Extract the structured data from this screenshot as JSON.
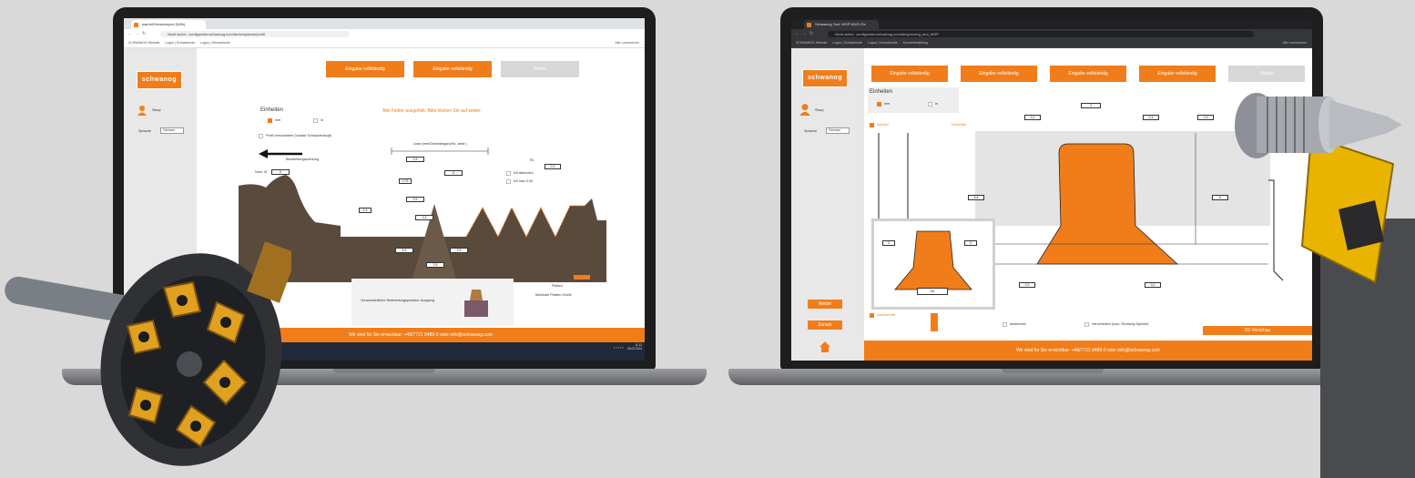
{
  "left_screen": {
    "browser": {
      "tab_title": "warnbl/Gewindeprof (Wilh)",
      "url_prefix": "Nicht sicher",
      "url": "configurator.schwanog.com/de/zerspanen/profil",
      "bookmarks": [
        "SCHWANOG Website",
        "Logos | Schwafmede",
        "Logos | Schwafmede"
      ],
      "bookmark_right": "Alle Lesezeichen"
    },
    "logo_text": "schwanog",
    "user_label": "Stavy",
    "language_label": "Sprache",
    "language_value": "German",
    "buttons": {
      "step1": "Eingabe vollständig",
      "step2": "Eingabe vollständig",
      "next": "Weiter"
    },
    "units": {
      "title": "Einheiten",
      "mm": "mm",
      "in": "in"
    },
    "profile_option": "Profil verschieben (Vorlauf Schraubenkopf)",
    "status_message": "Alle Felder ausgefüllt. Bitte klicken Sie auf weiter.",
    "direction_label": "Bearbeitungsrichtung",
    "lead_label": "Lead (mm/Gewindeganz/Nr. zahlr.)",
    "diameter_label": "Nom. Ø",
    "diameter_value": "6",
    "dims": {
      "p_value": "1,6",
      "a_value": "5",
      "r_value": "0.2",
      "w_value": "5,4",
      "h_value": "2,5",
      "d_value": "1,6",
      "b_value": "0,9",
      "s_value": "0,3",
      "c_value": "0,75",
      "f_value": "2,5"
    },
    "options": {
      "r1_label": "R1",
      "edge_break": "Kä abrunden",
      "max_label": "Kä max 0,00"
    },
    "result_panel": {
      "text": "Voraussichtliche Bearbeitungsposition: Ausgang",
      "side_label1": "Platten",
      "side_label2": "Minimale Platten Größe"
    },
    "footer": "Wir sind für Sie erreichbar: +49/7721 9489-0 oder info@schwanog.com",
    "clock_time": "11:12",
    "clock_date": "06.03.2024"
  },
  "right_screen": {
    "browser": {
      "tab_title": "Schwanog Tool: WSP 50/21 Re",
      "url_prefix": "Nicht sicher",
      "url": "configurator.schwanog.com/de/grooving_tool_WSP",
      "bookmarks": [
        "SCHWANOG Website",
        "Logos | Schwafmede",
        "Logos | Schwafmede",
        "Sonderbestellung"
      ],
      "bookmark_right": "Alle Lesezeichen"
    },
    "logo_text": "schwanog",
    "user_label": "Stavy",
    "language_label": "Sprache",
    "language_value": "German",
    "buttons": {
      "step1": "Eingabe vollständig",
      "step2": "Eingabe vollständig",
      "step3": "Eingabe vollständig",
      "step4": "Eingabe vollständig",
      "next": "Weiter"
    },
    "units": {
      "title": "Einheiten",
      "mm": "mm",
      "in": "in"
    },
    "spindle_label": "Spindel",
    "turning_label": "Drehmitte",
    "dims": {
      "b_value": "3",
      "r1_value": "0,1",
      "r2_value": "0,1",
      "d1_value": "2,4",
      "d2_value": "5,6",
      "d3_value": "5",
      "l1_value": "0,2",
      "l2_value": "0,2",
      "inset_left": "0",
      "inset_right": "0",
      "inset_ok": "OK"
    },
    "side_buttons": {
      "next": "Weiter",
      "back": "Zurück"
    },
    "bottom_options": {
      "post_process": "Nachschnitt",
      "grooving": "Abstechen",
      "shift": "Verschieben (max. Richtung Spindel)"
    },
    "preview_button": "3D Vorschau",
    "footer": "Wir sind für Sie erreichbar: +49/7721 9489-0 oder info@schwanog.com"
  },
  "colors": {
    "accent": "#f07d1a",
    "background": "#d9d9d9",
    "laptop_frame": "#1e1e1e",
    "profile_brown": "#5a4a3c"
  }
}
